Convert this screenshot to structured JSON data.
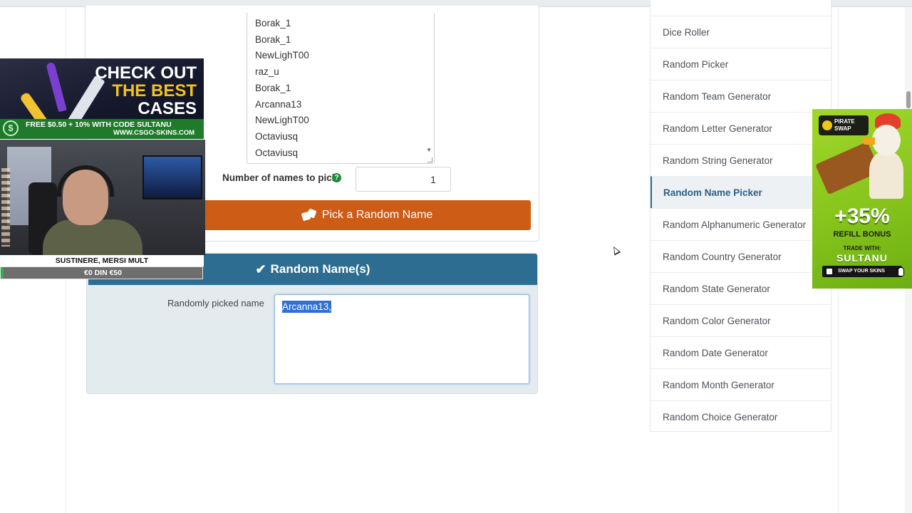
{
  "picker": {
    "names": [
      "Borak_1",
      "Borak_1",
      "NewLighT00",
      "raz_u",
      "Borak_1",
      "Arcanna13",
      "NewLighT00",
      "Octaviusq",
      "Octaviusq"
    ],
    "count_label": "Number of names to pick",
    "count_value": "1",
    "button_label": "Pick a Random Name"
  },
  "result": {
    "title": "Random Name(s)",
    "field_label": "Randomly picked name",
    "value": "Arcanna13,"
  },
  "sidebar": {
    "items": [
      {
        "label": "Dice Roller"
      },
      {
        "label": "Random Picker"
      },
      {
        "label": "Random Team Generator"
      },
      {
        "label": "Random Letter Generator"
      },
      {
        "label": "Random String Generator"
      },
      {
        "label": "Random Name Picker",
        "active": true
      },
      {
        "label": "Random Alphanumeric Generator"
      },
      {
        "label": "Random Country Generator"
      },
      {
        "label": "Random State Generator"
      },
      {
        "label": "Random Color Generator"
      },
      {
        "label": "Random Date Generator"
      },
      {
        "label": "Random Month Generator"
      },
      {
        "label": "Random Choice Generator"
      }
    ]
  },
  "overlay": {
    "cases_ad": {
      "line1": "CHECK OUT",
      "line2": "THE BEST",
      "line3": "CASES",
      "promo": "FREE $0.50 + 10% WITH CODE SULTANU",
      "url": "WWW.CSGO-SKINS.COM"
    },
    "donation": {
      "title": "SUSTINERE, MERSI MULT",
      "progress_text": "€0 DIN €50",
      "progress_fraction": 0.0
    },
    "pirate_ad": {
      "logo": "PIRATE SWAP",
      "bonus": "+35%",
      "refill": "REFILL BONUS",
      "trade": "TRADE WITH:",
      "code": "SULTANU",
      "button": "SWAP YOUR SKINS"
    }
  },
  "colors": {
    "pick_button": "#cd5c16",
    "result_header": "#2c6d91",
    "result_body": "#e4ebef",
    "selection": "#2f6fd6",
    "help_icon": "#1e8a3a"
  }
}
